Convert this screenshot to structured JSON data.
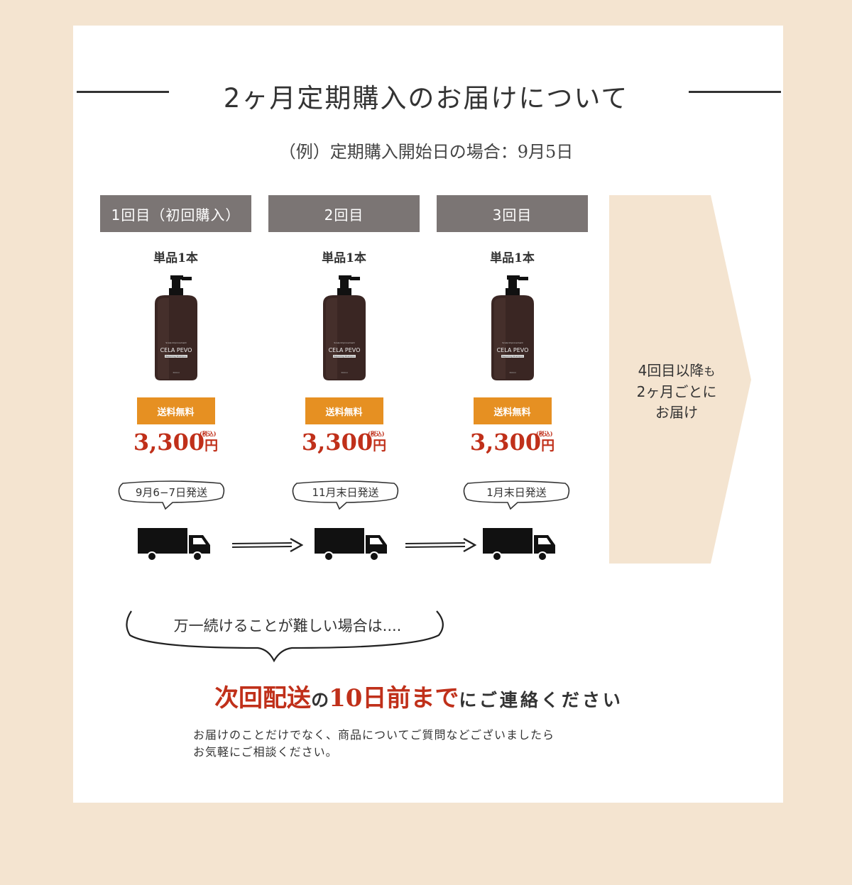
{
  "header": {
    "title": "2ヶ月定期購入のお届けについて",
    "subtitle": "（例）定期購入開始日の場合：9月5日"
  },
  "deliveries": [
    {
      "header": "1回目（初回購入）",
      "quantity": "単品1本",
      "badge": "送料無料",
      "price": "3,300",
      "yen": "円",
      "tax": "(税込)",
      "ship": "9月6−7日発送"
    },
    {
      "header": "2回目",
      "quantity": "単品1本",
      "badge": "送料無料",
      "price": "3,300",
      "yen": "円",
      "tax": "(税込)",
      "ship": "11月末日発送"
    },
    {
      "header": "3回目",
      "quantity": "単品1本",
      "badge": "送料無料",
      "price": "3,300",
      "yen": "円",
      "tax": "(税込)",
      "ship": "1月末日発送"
    }
  ],
  "bottle": {
    "brand": "CELA PEVO",
    "line": "Scalp Improvement",
    "type": "Repairing Shampoo",
    "volume": "300ml"
  },
  "side": {
    "line1_a": "4回目以降",
    "line1_b": "も",
    "line2": "2ヶ月ごとに",
    "line3": "お届け"
  },
  "notice": {
    "brace_text": "万一続けることが難しい場合は....",
    "cta_part1": "次回配送",
    "cta_part2": "の",
    "cta_part3": "10日前まで",
    "cta_part4": "にご連絡ください",
    "note_line1": "お届けのことだけでなく、商品についてご質問などございましたら",
    "note_line2": "お気軽にご相談ください。"
  },
  "colors": {
    "background": "#f4e4d0",
    "header_gray": "#7b7574",
    "badge_orange": "#e69022",
    "price_red": "#c0301a",
    "side_arrow": "#f4e4d0"
  }
}
